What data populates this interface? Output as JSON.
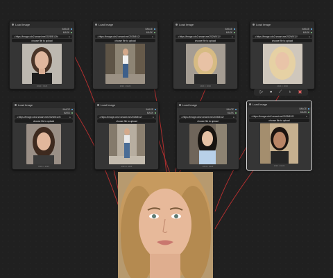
{
  "nodes": [
    {
      "title": "Load Image",
      "id": "#65",
      "url": "https://image.cdn2.seaart.me/2025/8/12/b",
      "upload": "choose file to upload",
      "out1": "IMAGE",
      "out2": "MASK",
      "caption": "1024 × 1024"
    },
    {
      "title": "Load Image",
      "id": "#67",
      "url": "https://image.cdn2.seaart.me/2025/8/12/",
      "upload": "choose file to upload",
      "out1": "IMAGE",
      "out2": "MASK",
      "caption": "1024 × 1024"
    },
    {
      "title": "Load Image",
      "id": "#70",
      "url": "https://image.cdn2.seaart.me/2025/8/12/",
      "upload": "choose file to upload",
      "out1": "IMAGE",
      "out2": "MASK",
      "caption": "1024 × 1024"
    },
    {
      "title": "Load Image",
      "id": "#71",
      "url": "https://image.cdn2.seaart.me/2025/8/12/",
      "upload": "choose file to upload",
      "out1": "IMAGE",
      "out2": "MASK",
      "caption": "1024 × 1024"
    },
    {
      "title": "Load Image",
      "id": "#63",
      "url": "https://image.cdn2.seaart.me/2025/8/12/b",
      "upload": "choose file to upload",
      "out1": "IMAGE",
      "out2": "MASK",
      "caption": "1024 × 1024"
    },
    {
      "title": "Load Image",
      "id": "#66",
      "url": "https://image.cdn2.seaart.me/2025/8/12/",
      "upload": "choose file to upload",
      "out1": "IMAGE",
      "out2": "MASK",
      "caption": "1024 × 1024"
    },
    {
      "title": "Load Image",
      "id": "#68",
      "url": "https://image.cdn2.seaart.me/2025/8/12/",
      "upload": "choose file to upload",
      "out1": "IMAGE",
      "out2": "MASK",
      "caption": "1024 × 1024"
    },
    {
      "title": "Load Image",
      "id": "#72",
      "url": "https://image.cdn2.seaart.me/2025/8/12/",
      "upload": "choose file to upload",
      "out1": "IMAGE",
      "out2": "MASK",
      "caption": "1024 × 1024"
    }
  ],
  "toolbar": {
    "icons": [
      "play-icon",
      "circle-icon",
      "wand-icon",
      "lightbulb-icon",
      "trash-icon"
    ]
  },
  "colors": {
    "canvas": "#202020",
    "node": "#353535",
    "wire": "#b83030",
    "image_out": "#64b5f6",
    "mask_out": "#81c784",
    "selected_border": "#d8d8d8"
  }
}
